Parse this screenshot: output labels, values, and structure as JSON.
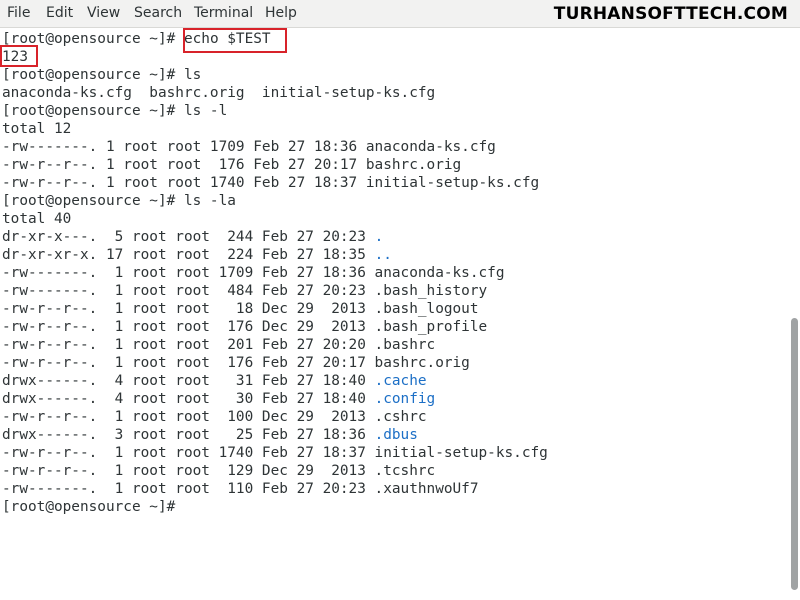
{
  "menu": [
    "File",
    "Edit",
    "View",
    "Search",
    "Terminal",
    "Help"
  ],
  "watermark": "TURHANSOFTTECH.COM",
  "terminal": {
    "lines": [
      {
        "parts": [
          {
            "text": "[root@opensource ~]# "
          },
          {
            "text": "echo $TEST"
          }
        ]
      },
      {
        "parts": [
          {
            "text": "123"
          }
        ]
      },
      {
        "parts": [
          {
            "text": "[root@opensource ~]# ls"
          }
        ]
      },
      {
        "parts": [
          {
            "text": "anaconda-ks.cfg  bashrc.orig  initial-setup-ks.cfg"
          }
        ]
      },
      {
        "parts": [
          {
            "text": "[root@opensource ~]# ls -l"
          }
        ]
      },
      {
        "parts": [
          {
            "text": "total 12"
          }
        ]
      },
      {
        "parts": [
          {
            "text": "-rw-------. 1 root root 1709 Feb 27 18:36 anaconda-ks.cfg"
          }
        ]
      },
      {
        "parts": [
          {
            "text": "-rw-r--r--. 1 root root  176 Feb 27 20:17 bashrc.orig"
          }
        ]
      },
      {
        "parts": [
          {
            "text": "-rw-r--r--. 1 root root 1740 Feb 27 18:37 initial-setup-ks.cfg"
          }
        ]
      },
      {
        "parts": [
          {
            "text": "[root@opensource ~]# ls -la"
          }
        ]
      },
      {
        "parts": [
          {
            "text": "total 40"
          }
        ]
      },
      {
        "parts": [
          {
            "text": "dr-xr-x---.  5 root root  244 Feb 27 20:23 "
          },
          {
            "text": ".",
            "dir": true
          }
        ]
      },
      {
        "parts": [
          {
            "text": "dr-xr-xr-x. 17 root root  224 Feb 27 18:35 "
          },
          {
            "text": "..",
            "dir": true
          }
        ]
      },
      {
        "parts": [
          {
            "text": "-rw-------.  1 root root 1709 Feb 27 18:36 anaconda-ks.cfg"
          }
        ]
      },
      {
        "parts": [
          {
            "text": "-rw-------.  1 root root  484 Feb 27 20:23 .bash_history"
          }
        ]
      },
      {
        "parts": [
          {
            "text": "-rw-r--r--.  1 root root   18 Dec 29  2013 .bash_logout"
          }
        ]
      },
      {
        "parts": [
          {
            "text": "-rw-r--r--.  1 root root  176 Dec 29  2013 .bash_profile"
          }
        ]
      },
      {
        "parts": [
          {
            "text": "-rw-r--r--.  1 root root  201 Feb 27 20:20 .bashrc"
          }
        ]
      },
      {
        "parts": [
          {
            "text": "-rw-r--r--.  1 root root  176 Feb 27 20:17 bashrc.orig"
          }
        ]
      },
      {
        "parts": [
          {
            "text": "drwx------.  4 root root   31 Feb 27 18:40 "
          },
          {
            "text": ".cache",
            "dir": true
          }
        ]
      },
      {
        "parts": [
          {
            "text": "drwx------.  4 root root   30 Feb 27 18:40 "
          },
          {
            "text": ".config",
            "dir": true
          }
        ]
      },
      {
        "parts": [
          {
            "text": "-rw-r--r--.  1 root root  100 Dec 29  2013 .cshrc"
          }
        ]
      },
      {
        "parts": [
          {
            "text": "drwx------.  3 root root   25 Feb 27 18:36 "
          },
          {
            "text": ".dbus",
            "dir": true
          }
        ]
      },
      {
        "parts": [
          {
            "text": "-rw-r--r--.  1 root root 1740 Feb 27 18:37 initial-setup-ks.cfg"
          }
        ]
      },
      {
        "parts": [
          {
            "text": "-rw-r--r--.  1 root root  129 Dec 29  2013 .tcshrc"
          }
        ]
      },
      {
        "parts": [
          {
            "text": "-rw-------.  1 root root  110 Feb 27 20:23 .xauthnwoUf7"
          }
        ]
      },
      {
        "parts": [
          {
            "text": "[root@opensource ~]# "
          }
        ]
      }
    ]
  },
  "colors": {
    "text": "#2e3436",
    "directory": "#1c6fc6",
    "highlight": "#d8232a"
  }
}
